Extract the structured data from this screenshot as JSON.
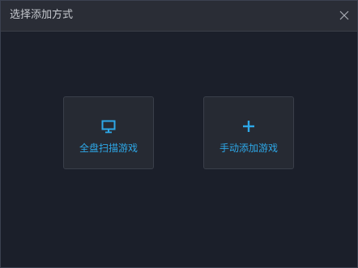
{
  "window": {
    "title": "选择添加方式"
  },
  "options": [
    {
      "label": "全盘扫描游戏",
      "icon": "monitor-icon"
    },
    {
      "label": "手动添加游戏",
      "icon": "plus-icon"
    }
  ],
  "colors": {
    "accent": "#2da8e8",
    "background": "#1b1f2a",
    "titlebar": "#2a2d36",
    "card": "#262a33"
  }
}
